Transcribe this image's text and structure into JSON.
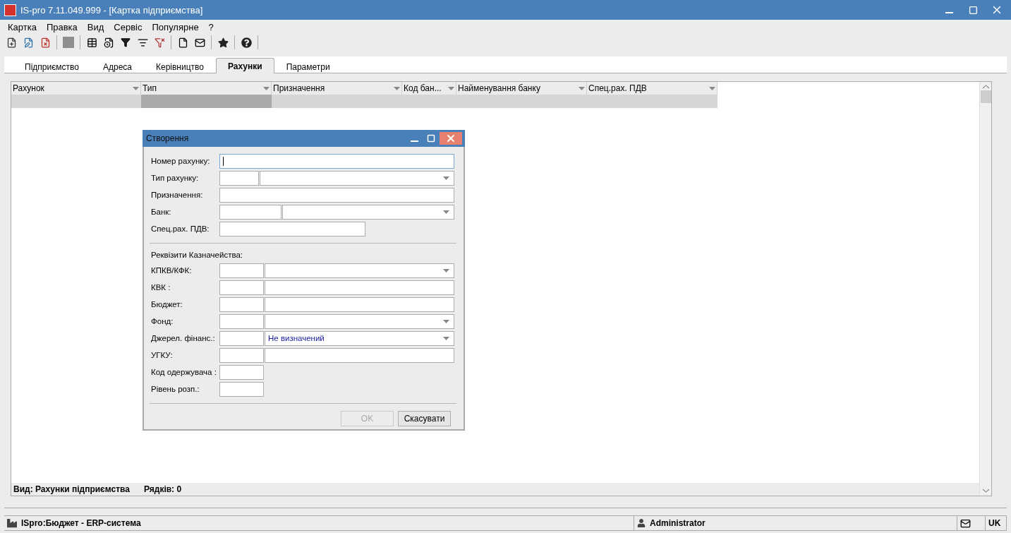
{
  "window": {
    "title": "IS-pro 7.11.049.999 - [Картка підприємства]"
  },
  "menu": [
    "Картка",
    "Правка",
    "Вид",
    "Сервіс",
    "Популярне",
    "?"
  ],
  "tabs": [
    {
      "label": "Підприємство",
      "selected": false
    },
    {
      "label": "Адреса",
      "selected": false
    },
    {
      "label": "Керівництво",
      "selected": false
    },
    {
      "label": "Рахунки",
      "selected": true
    },
    {
      "label": "Параметри",
      "selected": false
    }
  ],
  "table": {
    "columns": [
      "Рахунок",
      "Тип",
      "Призначення",
      "Код бан...",
      "Найменування банку",
      "Спец.рах. ПДВ"
    ],
    "view": "Вид: Рахунки підприємства",
    "row_count": "Рядків: 0"
  },
  "dialog": {
    "title": "Створення",
    "fields": [
      {
        "label": "Номер рахунку:",
        "kind": "text",
        "focused": true
      },
      {
        "label": "Тип рахунку:",
        "kind": "combo_pair",
        "focused": false
      },
      {
        "label": "Призначення:",
        "kind": "text",
        "focused": false
      },
      {
        "label": "Банк:",
        "kind": "combo_pair",
        "focused": false
      },
      {
        "label": "Спец.рах. ПДВ:",
        "kind": "short_text",
        "focused": false
      }
    ],
    "section": "Реквізити Казначейства:",
    "treasury": [
      {
        "label": "КПКВ/КФК:",
        "kind": "combo_pair"
      },
      {
        "label": "КВК :",
        "kind": "pair"
      },
      {
        "label": "Бюджет:",
        "kind": "pair"
      },
      {
        "label": "Фонд:",
        "kind": "combo_pair"
      },
      {
        "label": "Джерел. фінанс.:",
        "kind": "combo_pair",
        "value": "Не визначений"
      },
      {
        "label": "УГКУ:",
        "kind": "pair"
      },
      {
        "label": "Код одержувача :",
        "kind": "code"
      },
      {
        "label": "Рівень розп.:",
        "kind": "code"
      }
    ],
    "buttons": [
      {
        "label": "OK",
        "disabled": true
      },
      {
        "label": "Скасувати",
        "disabled": false
      }
    ]
  },
  "status_bar": {
    "app": "ISpro:Бюджет - ERP-система",
    "user": "Administrator",
    "language": "UK"
  }
}
